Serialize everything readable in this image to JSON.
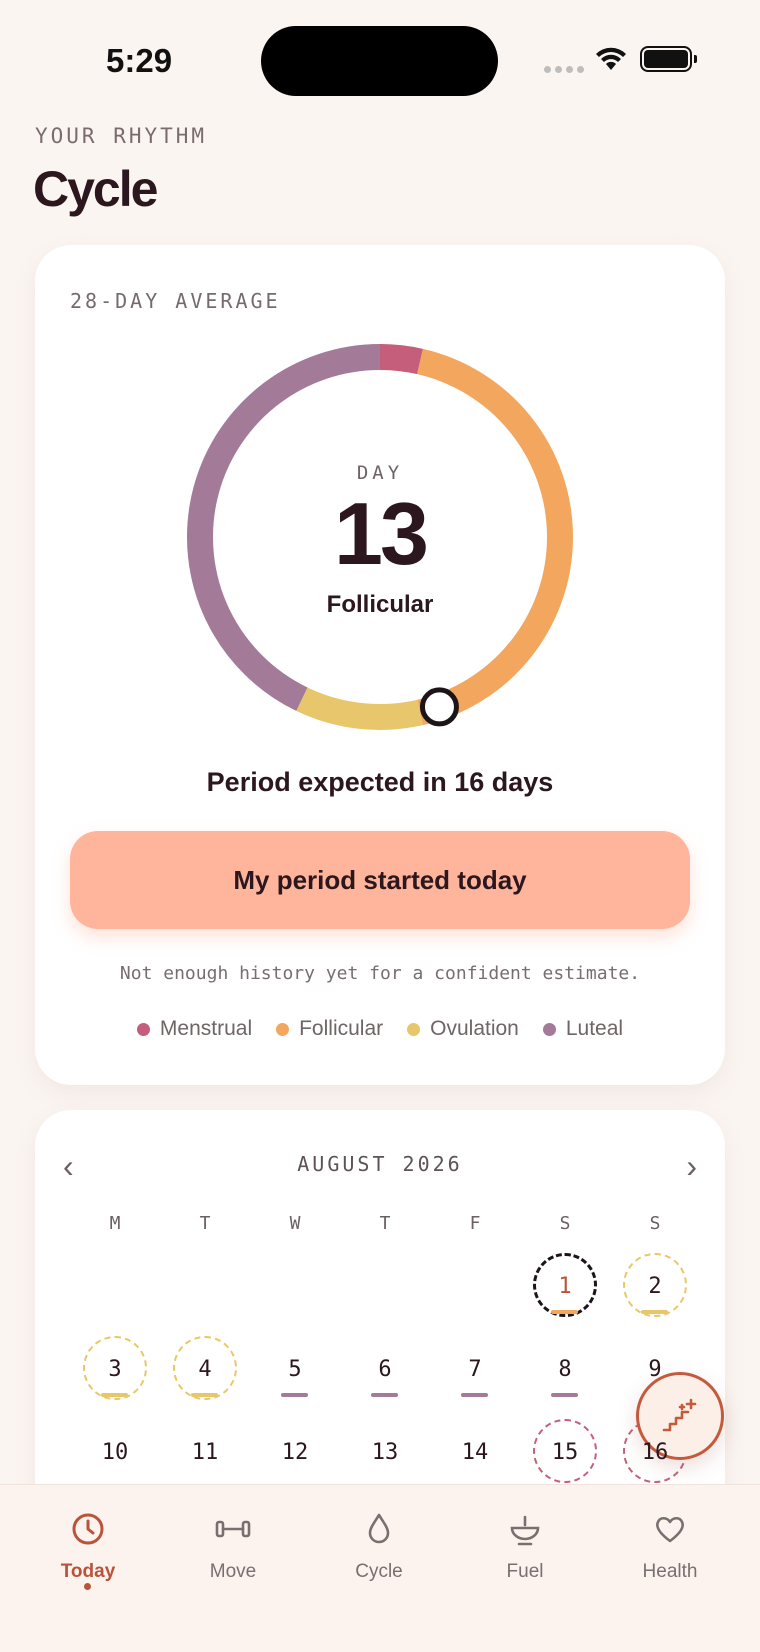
{
  "status_bar": {
    "time": "5:29"
  },
  "header": {
    "eyebrow": "YOUR RHYTHM",
    "title": "Cycle"
  },
  "cycle_card": {
    "label": "28-DAY AVERAGE",
    "day_label": "DAY",
    "day": "13",
    "phase": "Follicular",
    "expected": "Period expected in 16 days",
    "cta": "My period started today",
    "note": "Not enough history yet for a confident estimate.",
    "cycle_length_days": 28,
    "current_day": 13,
    "phases": [
      {
        "name": "Menstrual",
        "days": 1,
        "color": "#c45e7a"
      },
      {
        "name": "Follicular",
        "days": 12,
        "color": "#f2a65e"
      },
      {
        "name": "Ovulation",
        "days": 3,
        "color": "#e8c66c"
      },
      {
        "name": "Luteal",
        "days": 12,
        "color": "#a37b98"
      }
    ],
    "legend": [
      {
        "label": "Menstrual",
        "color": "#c45e7a"
      },
      {
        "label": "Follicular",
        "color": "#f2a65e"
      },
      {
        "label": "Ovulation",
        "color": "#e8c66c"
      },
      {
        "label": "Luteal",
        "color": "#a37b98"
      }
    ]
  },
  "calendar": {
    "prev": "‹",
    "next": "›",
    "month": "AUGUST 2026",
    "weekdays": [
      "M",
      "T",
      "W",
      "T",
      "F",
      "S",
      "S"
    ],
    "leading_blanks": 5,
    "days": [
      {
        "n": "1",
        "ring": "today",
        "bar": "#f2a65e"
      },
      {
        "n": "2",
        "ring": "ovulation",
        "bar": "#e8c66c"
      },
      {
        "n": "3",
        "ring": "ovulation",
        "bar": "#e8c66c"
      },
      {
        "n": "4",
        "ring": "ovulation",
        "bar": "#e8c66c"
      },
      {
        "n": "5",
        "ring": "",
        "bar": "#a37b98"
      },
      {
        "n": "6",
        "ring": "",
        "bar": "#a37b98"
      },
      {
        "n": "7",
        "ring": "",
        "bar": "#a37b98"
      },
      {
        "n": "8",
        "ring": "",
        "bar": "#a37b98"
      },
      {
        "n": "9",
        "ring": "",
        "bar": ""
      },
      {
        "n": "10",
        "ring": "",
        "bar": ""
      },
      {
        "n": "11",
        "ring": "",
        "bar": ""
      },
      {
        "n": "12",
        "ring": "",
        "bar": ""
      },
      {
        "n": "13",
        "ring": "",
        "bar": ""
      },
      {
        "n": "14",
        "ring": "",
        "bar": ""
      },
      {
        "n": "15",
        "ring": "menstrual",
        "bar": ""
      },
      {
        "n": "16",
        "ring": "menstrual",
        "bar": ""
      }
    ]
  },
  "fab": {
    "icon": "stairs-sparkle-icon"
  },
  "tabs": [
    {
      "label": "Today",
      "icon": "clock-icon",
      "active": true
    },
    {
      "label": "Move",
      "icon": "dumbbell-icon",
      "active": false
    },
    {
      "label": "Cycle",
      "icon": "drop-icon",
      "active": false
    },
    {
      "label": "Fuel",
      "icon": "bowl-icon",
      "active": false
    },
    {
      "label": "Health",
      "icon": "heart-icon",
      "active": false
    }
  ]
}
